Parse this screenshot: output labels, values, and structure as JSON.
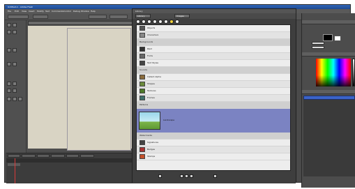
{
  "window": {
    "title": "Untitled-1 - Adobe Flash"
  },
  "menubar": {
    "items": [
      "File",
      "Edit",
      "View",
      "Insert",
      "Modify",
      "Text",
      "Commands",
      "Control",
      "Debug",
      "Window",
      "Help"
    ]
  },
  "library": {
    "title": "Library",
    "tabs": [
      "Library",
      "Images"
    ],
    "items": [
      "Objects",
      "Characters",
      "Backgrounds",
      "Paint",
      "Fonts",
      "Text Styles",
      "Sounds",
      "Instant Alpha",
      "Shapes",
      "Textures",
      "Frames",
      "Patterns",
      "Brushes",
      "Gradients"
    ],
    "selected_item": "Landscape",
    "items_after": [
      "Watermarks",
      "Signatures",
      "Badges",
      "Stamps"
    ]
  },
  "colors": {
    "titlebar": "#2f66b8",
    "selection": "#7b83c2",
    "layer_selection": "#3b63c9",
    "timeline_marker": "#d83a3a"
  }
}
